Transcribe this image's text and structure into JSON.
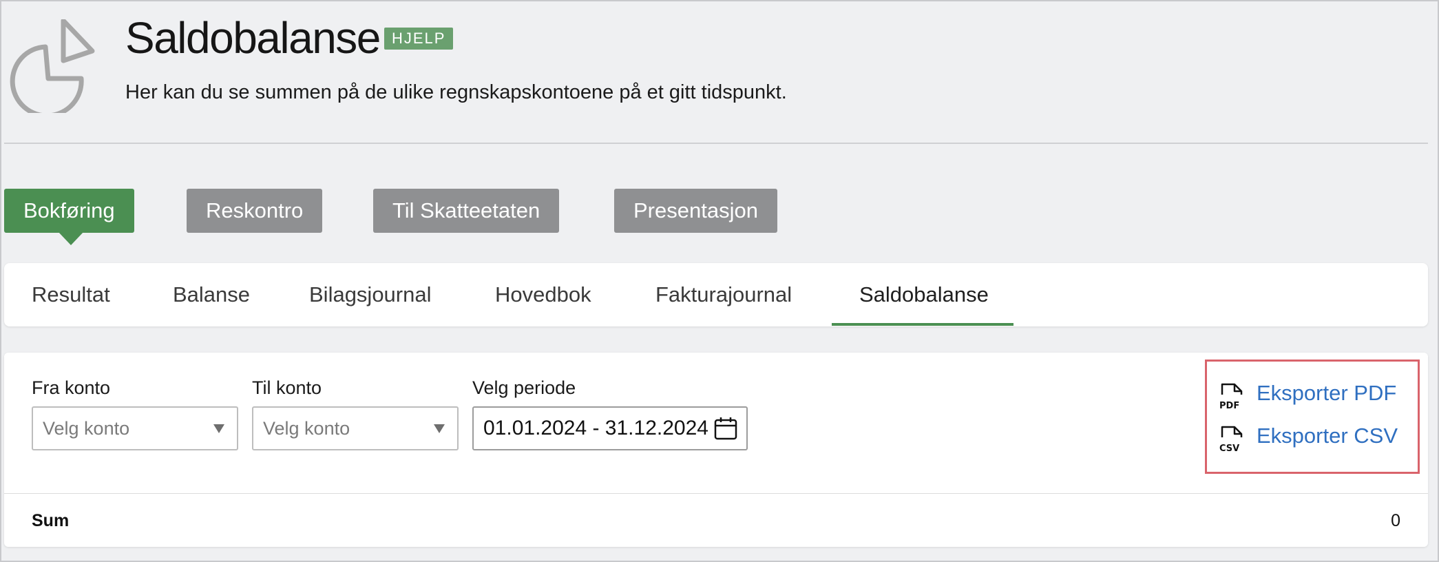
{
  "header": {
    "title": "Saldobalanse",
    "help_badge": "HJELP",
    "subtitle": "Her kan du se summen på de ulike regnskapskontoene på et gitt tidspunkt.",
    "icon": "pie-chart-icon"
  },
  "main_nav": {
    "items": [
      {
        "label": "Bokføring",
        "active": true
      },
      {
        "label": "Reskontro",
        "active": false
      },
      {
        "label": "Til Skatteetaten",
        "active": false
      },
      {
        "label": "Presentasjon",
        "active": false
      }
    ]
  },
  "sub_tabs": {
    "items": [
      {
        "label": "Resultat"
      },
      {
        "label": "Balanse"
      },
      {
        "label": "Bilagsjournal"
      },
      {
        "label": "Hovedbok"
      },
      {
        "label": "Fakturajournal"
      },
      {
        "label": "Saldobalanse",
        "active": true
      }
    ]
  },
  "filters": {
    "from_account": {
      "label": "Fra konto",
      "placeholder": "Velg konto"
    },
    "to_account": {
      "label": "Til konto",
      "placeholder": "Velg konto"
    },
    "period": {
      "label": "Velg periode",
      "value": "01.01.2024 - 31.12.2024"
    }
  },
  "export": {
    "pdf": {
      "label": "Eksporter PDF",
      "icon": "pdf-file-icon",
      "icon_text": "PDF"
    },
    "csv": {
      "label": "Eksporter CSV",
      "icon": "csv-file-icon",
      "icon_text": "CSV"
    }
  },
  "summary": {
    "label": "Sum",
    "value": "0"
  },
  "colors": {
    "accent_green": "#4b8f52",
    "inactive_button": "#8f9092",
    "link_blue": "#2f6fc0",
    "highlight_red": "#d9636b",
    "background": "#eff0f2"
  }
}
